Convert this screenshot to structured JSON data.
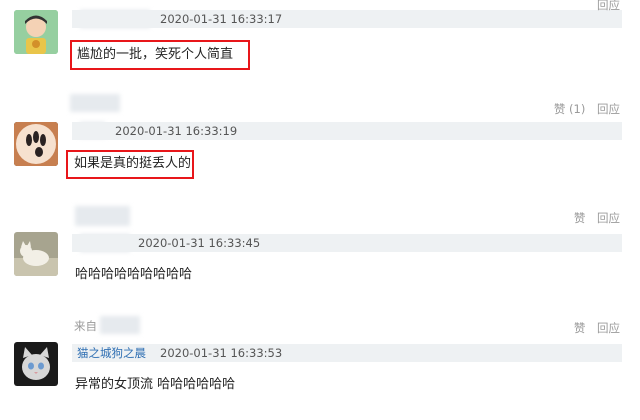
{
  "comments": [
    {
      "time": "2020-01-31 16:33:17",
      "text": "尴尬的一批，笑死个人简直",
      "actions": {
        "reply": "回应"
      }
    },
    {
      "time": "2020-01-31 16:33:19",
      "text": "如果是真的挺丢人的",
      "actions": {
        "like": "赞 (1)",
        "reply": "回应"
      }
    },
    {
      "time": "2020-01-31 16:33:45",
      "text": "哈哈哈哈哈哈哈哈哈",
      "actions": {
        "like": "赞",
        "reply": "回应"
      }
    },
    {
      "from_label": "来自",
      "username": "猫之城狗之晨",
      "time": "2020-01-31 16:33:53",
      "text": "异常的女顶流 哈哈哈哈哈哈",
      "actions": {
        "like": "赞",
        "reply": "回应"
      }
    }
  ]
}
